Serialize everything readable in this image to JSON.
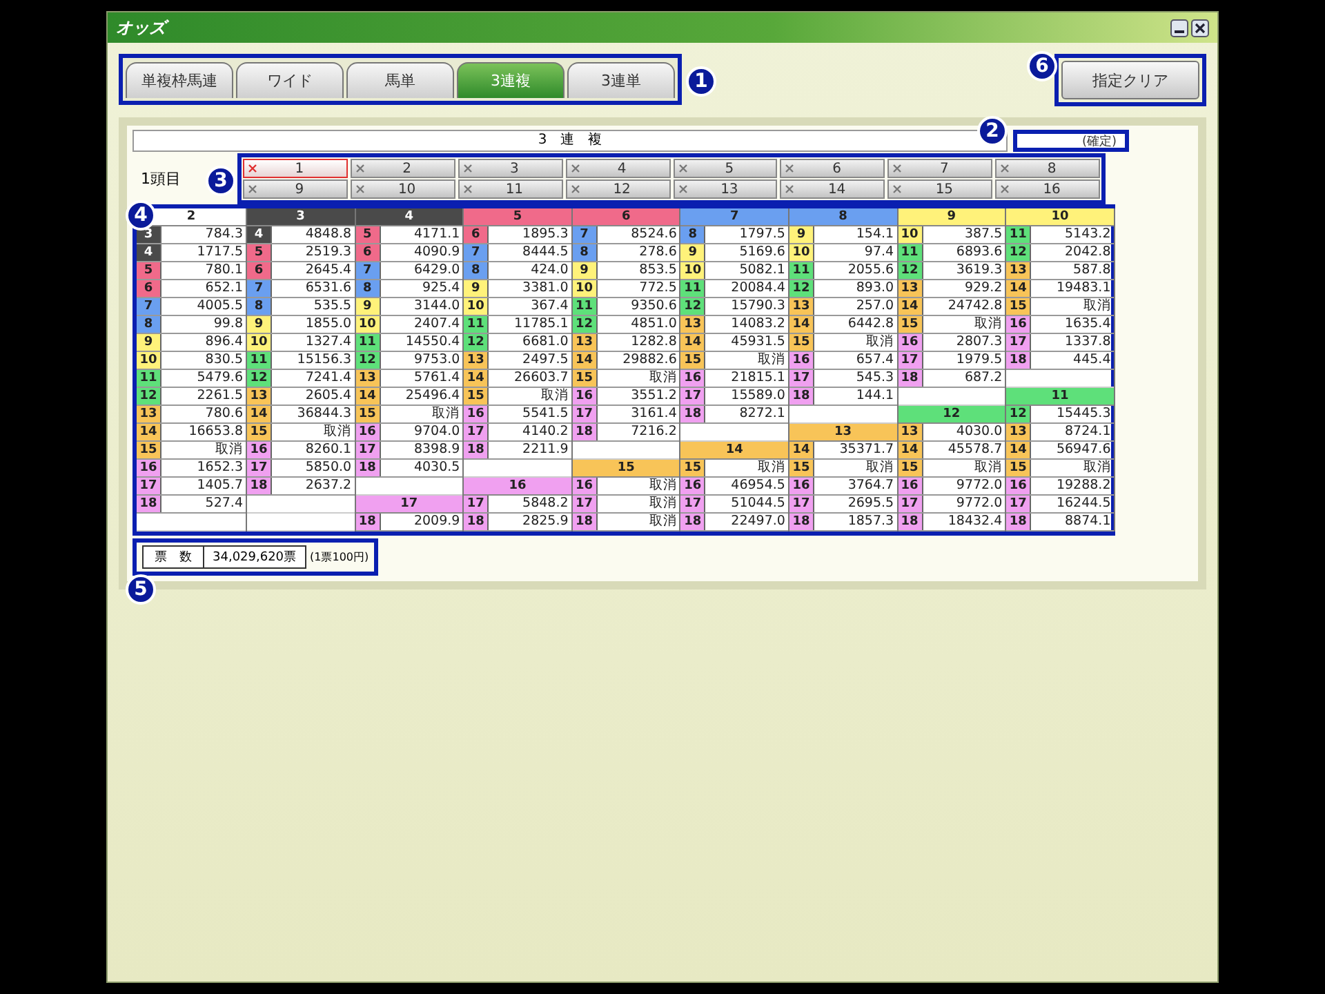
{
  "window": {
    "title": "オッズ"
  },
  "tabs": {
    "callout": "1",
    "items": [
      {
        "label": "単複枠馬連",
        "selected": false
      },
      {
        "label": "ワイド",
        "selected": false
      },
      {
        "label": "馬単",
        "selected": false
      },
      {
        "label": "3連複",
        "selected": true
      },
      {
        "label": "3連単",
        "selected": false
      }
    ]
  },
  "clear_button": {
    "label": "指定クリア",
    "callout": "6"
  },
  "table_title": "3　連　複",
  "status": {
    "label": "(確定)",
    "callout": "2"
  },
  "selector": {
    "label": "1頭目",
    "callout": "3",
    "buttons": [
      {
        "label": "1",
        "selected": true
      },
      {
        "label": "2",
        "selected": false
      },
      {
        "label": "3",
        "selected": false
      },
      {
        "label": "4",
        "selected": false
      },
      {
        "label": "5",
        "selected": false
      },
      {
        "label": "6",
        "selected": false
      },
      {
        "label": "7",
        "selected": false
      },
      {
        "label": "8",
        "selected": false
      },
      {
        "label": "9",
        "selected": false
      },
      {
        "label": "10",
        "selected": false
      },
      {
        "label": "11",
        "selected": false
      },
      {
        "label": "12",
        "selected": false
      },
      {
        "label": "13",
        "selected": false
      },
      {
        "label": "14",
        "selected": false
      },
      {
        "label": "15",
        "selected": false
      },
      {
        "label": "16",
        "selected": false
      }
    ]
  },
  "odds": {
    "callout": "4",
    "blocks": [
      {
        "segments": [
          {
            "head": {
              "num": "2",
              "color": "#ffffff"
            },
            "rows": [
              {
                "num": "3",
                "color": "#4a4a4a",
                "odds": "784.3"
              },
              {
                "num": "4",
                "color": "#4a4a4a",
                "odds": "1717.5"
              },
              {
                "num": "5",
                "color": "#f06a8a",
                "odds": "780.1"
              },
              {
                "num": "6",
                "color": "#f06a8a",
                "odds": "652.1"
              },
              {
                "num": "7",
                "color": "#6a9ff0",
                "odds": "4005.5"
              },
              {
                "num": "8",
                "color": "#6a9ff0",
                "odds": "99.8"
              },
              {
                "num": "9",
                "color": "#fff27a",
                "odds": "896.4"
              },
              {
                "num": "10",
                "color": "#fff27a",
                "odds": "830.5"
              },
              {
                "num": "11",
                "color": "#5ee07a",
                "odds": "5479.6"
              },
              {
                "num": "12",
                "color": "#5ee07a",
                "odds": "2261.5"
              },
              {
                "num": "13",
                "color": "#f8c458",
                "odds": "780.6"
              },
              {
                "num": "14",
                "color": "#f8c458",
                "odds": "16653.8"
              },
              {
                "num": "15",
                "color": "#f8c458",
                "odds": "取消"
              },
              {
                "num": "16",
                "color": "#f0a0f0",
                "odds": "1652.3"
              },
              {
                "num": "17",
                "color": "#f0a0f0",
                "odds": "1405.7"
              },
              {
                "num": "18",
                "color": "#f0a0f0",
                "odds": "527.4"
              }
            ]
          }
        ]
      },
      {
        "segments": [
          {
            "head": {
              "num": "3",
              "color": "#4a4a4a"
            },
            "rows": [
              {
                "num": "4",
                "color": "#4a4a4a",
                "odds": "4848.8"
              },
              {
                "num": "5",
                "color": "#f06a8a",
                "odds": "2519.3"
              },
              {
                "num": "6",
                "color": "#f06a8a",
                "odds": "2645.4"
              },
              {
                "num": "7",
                "color": "#6a9ff0",
                "odds": "6531.6"
              },
              {
                "num": "8",
                "color": "#6a9ff0",
                "odds": "535.5"
              },
              {
                "num": "9",
                "color": "#fff27a",
                "odds": "1855.0"
              },
              {
                "num": "10",
                "color": "#fff27a",
                "odds": "1327.4"
              },
              {
                "num": "11",
                "color": "#5ee07a",
                "odds": "15156.3"
              },
              {
                "num": "12",
                "color": "#5ee07a",
                "odds": "7241.4"
              },
              {
                "num": "13",
                "color": "#f8c458",
                "odds": "2605.4"
              },
              {
                "num": "14",
                "color": "#f8c458",
                "odds": "36844.3"
              },
              {
                "num": "15",
                "color": "#f8c458",
                "odds": "取消"
              },
              {
                "num": "16",
                "color": "#f0a0f0",
                "odds": "8260.1"
              },
              {
                "num": "17",
                "color": "#f0a0f0",
                "odds": "5850.0"
              },
              {
                "num": "18",
                "color": "#f0a0f0",
                "odds": "2637.2"
              }
            ]
          }
        ]
      },
      {
        "segments": [
          {
            "head": {
              "num": "4",
              "color": "#4a4a4a"
            },
            "rows": [
              {
                "num": "5",
                "color": "#f06a8a",
                "odds": "4171.1"
              },
              {
                "num": "6",
                "color": "#f06a8a",
                "odds": "4090.9"
              },
              {
                "num": "7",
                "color": "#6a9ff0",
                "odds": "6429.0"
              },
              {
                "num": "8",
                "color": "#6a9ff0",
                "odds": "925.4"
              },
              {
                "num": "9",
                "color": "#fff27a",
                "odds": "3144.0"
              },
              {
                "num": "10",
                "color": "#fff27a",
                "odds": "2407.4"
              },
              {
                "num": "11",
                "color": "#5ee07a",
                "odds": "14550.4"
              },
              {
                "num": "12",
                "color": "#5ee07a",
                "odds": "9753.0"
              },
              {
                "num": "13",
                "color": "#f8c458",
                "odds": "5761.4"
              },
              {
                "num": "14",
                "color": "#f8c458",
                "odds": "25496.4"
              },
              {
                "num": "15",
                "color": "#f8c458",
                "odds": "取消"
              },
              {
                "num": "16",
                "color": "#f0a0f0",
                "odds": "9704.0"
              },
              {
                "num": "17",
                "color": "#f0a0f0",
                "odds": "8398.9"
              },
              {
                "num": "18",
                "color": "#f0a0f0",
                "odds": "4030.5"
              }
            ]
          },
          {
            "head": {
              "num": "17",
              "color": "#f0a0f0"
            },
            "rows": [
              {
                "num": "18",
                "color": "#f0a0f0",
                "odds": "2009.9"
              }
            ]
          }
        ]
      },
      {
        "segments": [
          {
            "head": {
              "num": "5",
              "color": "#f06a8a"
            },
            "rows": [
              {
                "num": "6",
                "color": "#f06a8a",
                "odds": "1895.3"
              },
              {
                "num": "7",
                "color": "#6a9ff0",
                "odds": "8444.5"
              },
              {
                "num": "8",
                "color": "#6a9ff0",
                "odds": "424.0"
              },
              {
                "num": "9",
                "color": "#fff27a",
                "odds": "3381.0"
              },
              {
                "num": "10",
                "color": "#fff27a",
                "odds": "367.4"
              },
              {
                "num": "11",
                "color": "#5ee07a",
                "odds": "11785.1"
              },
              {
                "num": "12",
                "color": "#5ee07a",
                "odds": "6681.0"
              },
              {
                "num": "13",
                "color": "#f8c458",
                "odds": "2497.5"
              },
              {
                "num": "14",
                "color": "#f8c458",
                "odds": "26603.7"
              },
              {
                "num": "15",
                "color": "#f8c458",
                "odds": "取消"
              },
              {
                "num": "16",
                "color": "#f0a0f0",
                "odds": "5541.5"
              },
              {
                "num": "17",
                "color": "#f0a0f0",
                "odds": "4140.2"
              },
              {
                "num": "18",
                "color": "#f0a0f0",
                "odds": "2211.9"
              }
            ]
          },
          {
            "head": {
              "num": "16",
              "color": "#f0a0f0"
            },
            "rows": [
              {
                "num": "17",
                "color": "#f0a0f0",
                "odds": "5848.2"
              },
              {
                "num": "18",
                "color": "#f0a0f0",
                "odds": "2825.9"
              }
            ]
          }
        ]
      },
      {
        "segments": [
          {
            "head": {
              "num": "6",
              "color": "#f06a8a"
            },
            "rows": [
              {
                "num": "7",
                "color": "#6a9ff0",
                "odds": "8524.6"
              },
              {
                "num": "8",
                "color": "#6a9ff0",
                "odds": "278.6"
              },
              {
                "num": "9",
                "color": "#fff27a",
                "odds": "853.5"
              },
              {
                "num": "10",
                "color": "#fff27a",
                "odds": "772.5"
              },
              {
                "num": "11",
                "color": "#5ee07a",
                "odds": "9350.6"
              },
              {
                "num": "12",
                "color": "#5ee07a",
                "odds": "4851.0"
              },
              {
                "num": "13",
                "color": "#f8c458",
                "odds": "1282.8"
              },
              {
                "num": "14",
                "color": "#f8c458",
                "odds": "29882.6"
              },
              {
                "num": "15",
                "color": "#f8c458",
                "odds": "取消"
              },
              {
                "num": "16",
                "color": "#f0a0f0",
                "odds": "3551.2"
              },
              {
                "num": "17",
                "color": "#f0a0f0",
                "odds": "3161.4"
              },
              {
                "num": "18",
                "color": "#f0a0f0",
                "odds": "7216.2"
              }
            ]
          },
          {
            "head": {
              "num": "15",
              "color": "#f8c458"
            },
            "rows": [
              {
                "num": "16",
                "color": "#f0a0f0",
                "odds": "取消"
              },
              {
                "num": "17",
                "color": "#f0a0f0",
                "odds": "取消"
              },
              {
                "num": "18",
                "color": "#f0a0f0",
                "odds": "取消"
              }
            ]
          }
        ]
      },
      {
        "segments": [
          {
            "head": {
              "num": "7",
              "color": "#6a9ff0"
            },
            "rows": [
              {
                "num": "8",
                "color": "#6a9ff0",
                "odds": "1797.5"
              },
              {
                "num": "9",
                "color": "#fff27a",
                "odds": "5169.6"
              },
              {
                "num": "10",
                "color": "#fff27a",
                "odds": "5082.1"
              },
              {
                "num": "11",
                "color": "#5ee07a",
                "odds": "20084.4"
              },
              {
                "num": "12",
                "color": "#5ee07a",
                "odds": "15790.3"
              },
              {
                "num": "13",
                "color": "#f8c458",
                "odds": "14083.2"
              },
              {
                "num": "14",
                "color": "#f8c458",
                "odds": "45931.5"
              },
              {
                "num": "15",
                "color": "#f8c458",
                "odds": "取消"
              },
              {
                "num": "16",
                "color": "#f0a0f0",
                "odds": "21815.1"
              },
              {
                "num": "17",
                "color": "#f0a0f0",
                "odds": "15589.0"
              },
              {
                "num": "18",
                "color": "#f0a0f0",
                "odds": "8272.1"
              }
            ]
          },
          {
            "head": {
              "num": "14",
              "color": "#f8c458"
            },
            "rows": [
              {
                "num": "15",
                "color": "#f8c458",
                "odds": "取消"
              },
              {
                "num": "16",
                "color": "#f0a0f0",
                "odds": "46954.5"
              },
              {
                "num": "17",
                "color": "#f0a0f0",
                "odds": "51044.5"
              },
              {
                "num": "18",
                "color": "#f0a0f0",
                "odds": "22497.0"
              }
            ]
          }
        ]
      },
      {
        "segments": [
          {
            "head": {
              "num": "8",
              "color": "#6a9ff0"
            },
            "rows": [
              {
                "num": "9",
                "color": "#fff27a",
                "odds": "154.1"
              },
              {
                "num": "10",
                "color": "#fff27a",
                "odds": "97.4"
              },
              {
                "num": "11",
                "color": "#5ee07a",
                "odds": "2055.6"
              },
              {
                "num": "12",
                "color": "#5ee07a",
                "odds": "893.0"
              },
              {
                "num": "13",
                "color": "#f8c458",
                "odds": "257.0"
              },
              {
                "num": "14",
                "color": "#f8c458",
                "odds": "6442.8"
              },
              {
                "num": "15",
                "color": "#f8c458",
                "odds": "取消"
              },
              {
                "num": "16",
                "color": "#f0a0f0",
                "odds": "657.4"
              },
              {
                "num": "17",
                "color": "#f0a0f0",
                "odds": "545.3"
              },
              {
                "num": "18",
                "color": "#f0a0f0",
                "odds": "144.1"
              }
            ]
          },
          {
            "head": {
              "num": "13",
              "color": "#f8c458"
            },
            "rows": [
              {
                "num": "14",
                "color": "#f8c458",
                "odds": "35371.7"
              },
              {
                "num": "15",
                "color": "#f8c458",
                "odds": "取消"
              },
              {
                "num": "16",
                "color": "#f0a0f0",
                "odds": "3764.7"
              },
              {
                "num": "17",
                "color": "#f0a0f0",
                "odds": "2695.5"
              },
              {
                "num": "18",
                "color": "#f0a0f0",
                "odds": "1857.3"
              }
            ]
          }
        ]
      },
      {
        "segments": [
          {
            "head": {
              "num": "9",
              "color": "#fff27a"
            },
            "rows": [
              {
                "num": "10",
                "color": "#fff27a",
                "odds": "387.5"
              },
              {
                "num": "11",
                "color": "#5ee07a",
                "odds": "6893.6"
              },
              {
                "num": "12",
                "color": "#5ee07a",
                "odds": "3619.3"
              },
              {
                "num": "13",
                "color": "#f8c458",
                "odds": "929.2"
              },
              {
                "num": "14",
                "color": "#f8c458",
                "odds": "24742.8"
              },
              {
                "num": "15",
                "color": "#f8c458",
                "odds": "取消"
              },
              {
                "num": "16",
                "color": "#f0a0f0",
                "odds": "2807.3"
              },
              {
                "num": "17",
                "color": "#f0a0f0",
                "odds": "1979.5"
              },
              {
                "num": "18",
                "color": "#f0a0f0",
                "odds": "687.2"
              }
            ]
          },
          {
            "head": {
              "num": "12",
              "color": "#5ee07a"
            },
            "rows": [
              {
                "num": "13",
                "color": "#f8c458",
                "odds": "4030.0"
              },
              {
                "num": "14",
                "color": "#f8c458",
                "odds": "45578.7"
              },
              {
                "num": "15",
                "color": "#f8c458",
                "odds": "取消"
              },
              {
                "num": "16",
                "color": "#f0a0f0",
                "odds": "9772.0"
              },
              {
                "num": "17",
                "color": "#f0a0f0",
                "odds": "9772.0"
              },
              {
                "num": "18",
                "color": "#f0a0f0",
                "odds": "18432.4"
              }
            ]
          }
        ]
      },
      {
        "segments": [
          {
            "head": {
              "num": "10",
              "color": "#fff27a"
            },
            "rows": [
              {
                "num": "11",
                "color": "#5ee07a",
                "odds": "5143.2"
              },
              {
                "num": "12",
                "color": "#5ee07a",
                "odds": "2042.8"
              },
              {
                "num": "13",
                "color": "#f8c458",
                "odds": "587.8"
              },
              {
                "num": "14",
                "color": "#f8c458",
                "odds": "19483.1"
              },
              {
                "num": "15",
                "color": "#f8c458",
                "odds": "取消"
              },
              {
                "num": "16",
                "color": "#f0a0f0",
                "odds": "1635.4"
              },
              {
                "num": "17",
                "color": "#f0a0f0",
                "odds": "1337.8"
              },
              {
                "num": "18",
                "color": "#f0a0f0",
                "odds": "445.4"
              }
            ]
          },
          {
            "head": {
              "num": "11",
              "color": "#5ee07a"
            },
            "rows": [
              {
                "num": "12",
                "color": "#5ee07a",
                "odds": "15445.3"
              },
              {
                "num": "13",
                "color": "#f8c458",
                "odds": "8724.1"
              },
              {
                "num": "14",
                "color": "#f8c458",
                "odds": "56947.6"
              },
              {
                "num": "15",
                "color": "#f8c458",
                "odds": "取消"
              },
              {
                "num": "16",
                "color": "#f0a0f0",
                "odds": "19288.2"
              },
              {
                "num": "17",
                "color": "#f0a0f0",
                "odds": "16244.5"
              },
              {
                "num": "18",
                "color": "#f0a0f0",
                "odds": "8874.1"
              }
            ]
          }
        ]
      }
    ]
  },
  "votes": {
    "label": "票　数",
    "value": "34,029,620票",
    "note": "(1票100円)",
    "callout": "5"
  }
}
